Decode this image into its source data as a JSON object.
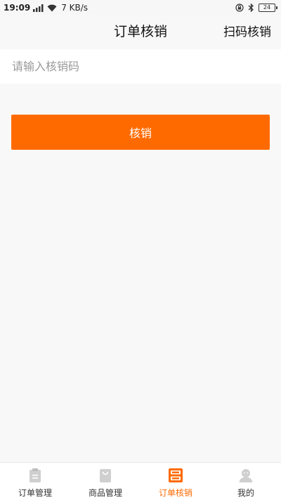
{
  "status_bar": {
    "time": "19:09",
    "network_speed": "7 KB/s",
    "battery": "24"
  },
  "header": {
    "title": "订单核销",
    "scan_label": "扫码核销"
  },
  "verify_input": {
    "placeholder": "请输入核销码",
    "value": ""
  },
  "verify_button": {
    "label": "核销"
  },
  "tabbar": {
    "tabs": [
      {
        "label": "订单管理",
        "icon": "clipboard-icon",
        "active": false
      },
      {
        "label": "商品管理",
        "icon": "shopping-bag-icon",
        "active": false
      },
      {
        "label": "订单核销",
        "icon": "scan-icon",
        "active": true
      },
      {
        "label": "我的",
        "icon": "user-icon",
        "active": false
      }
    ]
  },
  "colors": {
    "accent": "#ff6a00",
    "inactive_icon": "#cfcfcf",
    "background": "#f8f8f8"
  }
}
